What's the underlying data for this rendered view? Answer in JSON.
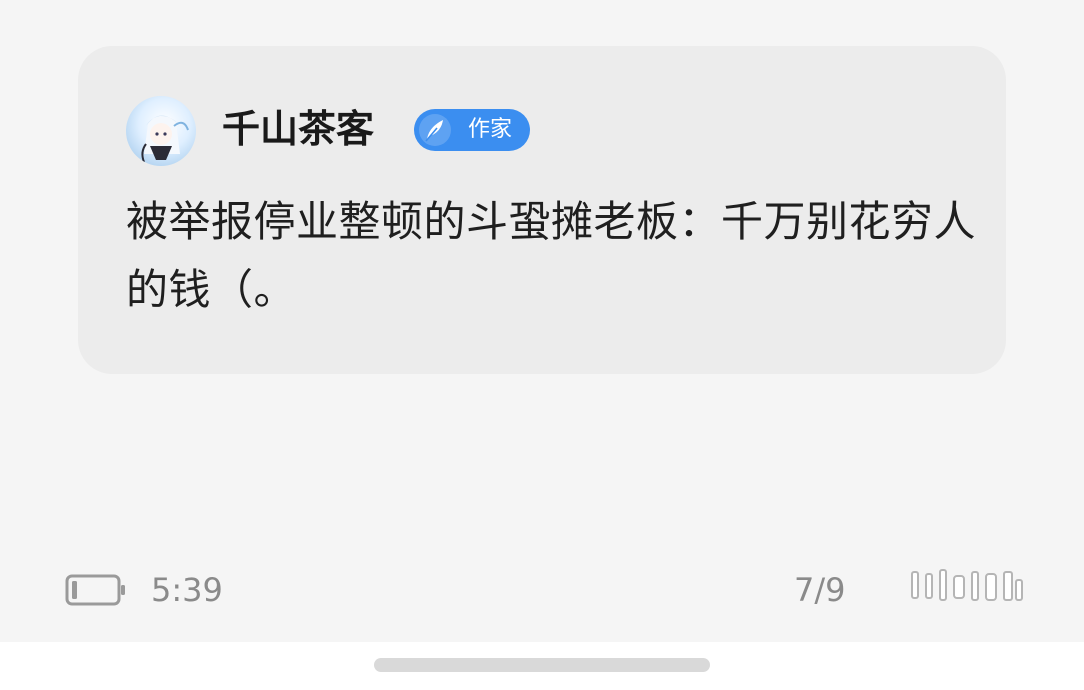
{
  "post": {
    "author_name": "千山茶客",
    "author_badge": "作家",
    "text": "被举报停业整顿的斗蛩摊老板：千万别花穷人的钱（。"
  },
  "status": {
    "time": "5:39",
    "page_counter": "7/9"
  },
  "icons": {
    "avatar": "anime-avatar",
    "badge": "quill-feather-icon",
    "battery": "battery-icon",
    "watermark": "app-watermark-logo"
  },
  "colors": {
    "badge": "#3b8ef0",
    "card_background": "#ececec",
    "page_background": "#f5f5f5",
    "status_text": "#8a8a8a"
  }
}
